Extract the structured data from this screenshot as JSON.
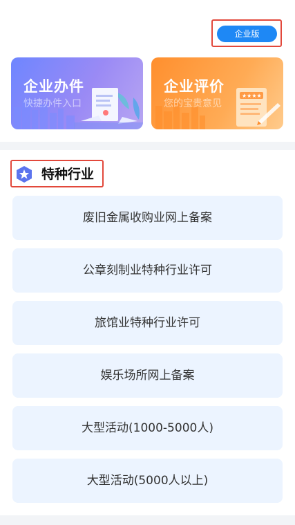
{
  "header": {
    "enterprise_button": "企业版"
  },
  "cards": [
    {
      "title": "企业办件",
      "subtitle": "快捷办件入口"
    },
    {
      "title": "企业评价",
      "subtitle": "您的宝贵意见"
    }
  ],
  "section": {
    "title": "特种行业",
    "icon": "star-badge-icon"
  },
  "items": [
    {
      "label": "废旧金属收购业网上备案"
    },
    {
      "label": "公章刻制业特种行业许可"
    },
    {
      "label": "旅馆业特种行业许可"
    },
    {
      "label": "娱乐场所网上备案"
    },
    {
      "label": "大型活动(1000-5000人)"
    },
    {
      "label": "大型活动(5000人以上)"
    }
  ],
  "colors": {
    "accent": "#1e88f5",
    "highlight": "#e2483b",
    "item_bg": "#ecf4ff",
    "section_icon": "#5c74ee"
  }
}
